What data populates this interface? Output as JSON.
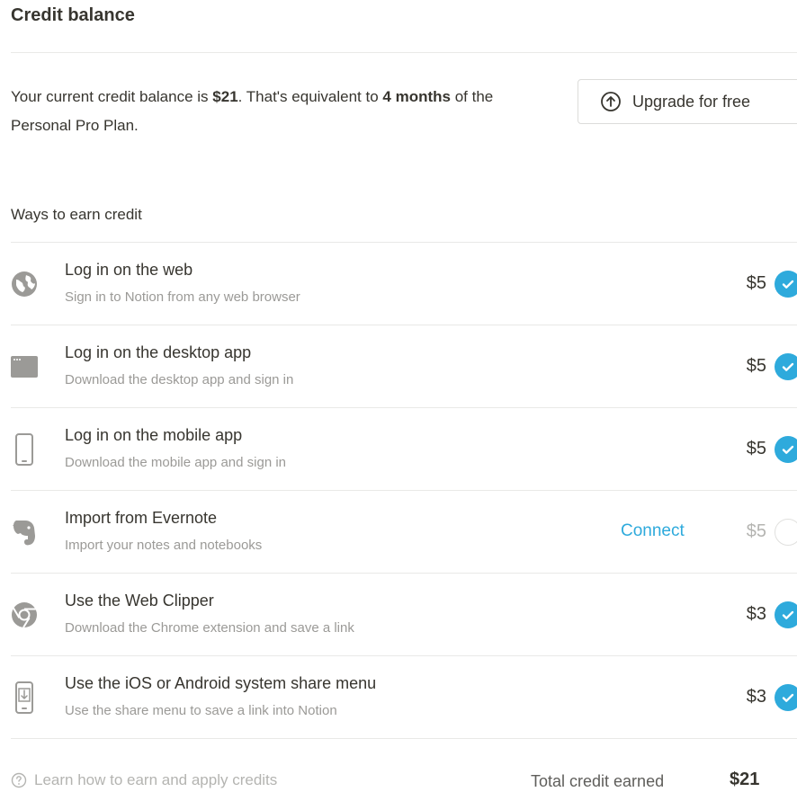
{
  "header": {
    "title": "Credit balance"
  },
  "balance": {
    "text_prefix": "Your current credit balance is ",
    "amount": "$21",
    "text_middle": ". That's equivalent to ",
    "months": "4 months",
    "text_suffix": " of the Personal Pro Plan."
  },
  "upgrade": {
    "label": "Upgrade for free",
    "icon": "arrow-up-circle-icon"
  },
  "earn": {
    "label": "Ways to earn credit",
    "items": [
      {
        "title": "Log in on the web",
        "subtitle": "Sign in to Notion from any web browser",
        "amount": "$5",
        "completed": true,
        "icon": "globe-icon"
      },
      {
        "title": "Log in on the desktop app",
        "subtitle": "Download the desktop app and sign in",
        "amount": "$5",
        "completed": true,
        "icon": "desktop-app-icon"
      },
      {
        "title": "Log in on the mobile app",
        "subtitle": "Download the mobile app and sign in",
        "amount": "$5",
        "completed": true,
        "icon": "mobile-phone-icon"
      },
      {
        "title": "Import from Evernote",
        "subtitle": "Import your notes and notebooks",
        "amount": "$5",
        "completed": false,
        "action": "Connect",
        "icon": "evernote-icon"
      },
      {
        "title": "Use the Web Clipper",
        "subtitle": "Download the Chrome extension and save a link",
        "amount": "$3",
        "completed": true,
        "icon": "chrome-icon"
      },
      {
        "title": "Use the iOS or Android system share menu",
        "subtitle": "Use the share menu to save a link into Notion",
        "amount": "$3",
        "completed": true,
        "icon": "share-phone-icon"
      }
    ]
  },
  "footer": {
    "learn_link": "Learn how to earn and apply credits",
    "total_label": "Total credit earned",
    "total_value": "$21"
  },
  "colors": {
    "accent": "#2eaadc",
    "text": "#37352f",
    "muted": "#9b9a97",
    "divider": "#e9e9e7"
  }
}
